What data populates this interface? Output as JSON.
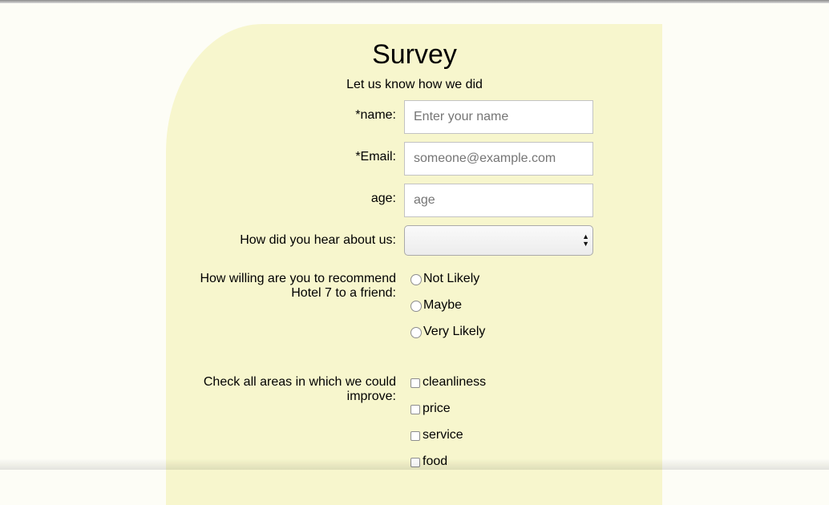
{
  "header": {
    "title": "Survey",
    "subtitle": "Let us know how we did"
  },
  "fields": {
    "name": {
      "label": "*name:",
      "placeholder": "Enter your name",
      "value": ""
    },
    "email": {
      "label": "*Email:",
      "placeholder": "someone@example.com",
      "value": ""
    },
    "age": {
      "label": "age:",
      "placeholder": "age",
      "value": ""
    },
    "referral": {
      "label": "How did you hear about us:",
      "selected": ""
    }
  },
  "recommend": {
    "label": "How willing are you to recommend Hotel 7 to a friend:",
    "options": [
      "Not Likely",
      "Maybe",
      "Very Likely"
    ]
  },
  "improve": {
    "label": "Check all areas in which we could improve:",
    "options": [
      "cleanliness",
      "price",
      "service",
      "food"
    ]
  },
  "colors": {
    "background": "#fdfdf6",
    "card": "#f7f6cd"
  }
}
